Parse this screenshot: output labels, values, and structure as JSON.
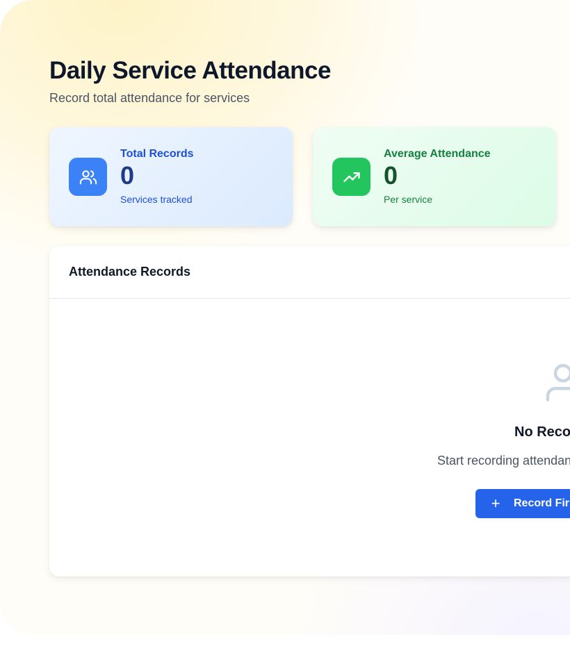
{
  "header": {
    "title": "Daily Service Attendance",
    "subtitle": "Record total attendance for services"
  },
  "stats": [
    {
      "label": "Total Records",
      "value": "0",
      "caption": "Services tracked",
      "icon": "users-icon",
      "color": "#3b82f6"
    },
    {
      "label": "Average Attendance",
      "value": "0",
      "caption": "Per service",
      "icon": "trending-up-icon",
      "color": "#22c55e"
    }
  ],
  "records": {
    "title": "Attendance Records",
    "empty_icon": "user-icon",
    "empty_title": "No Records Yet",
    "empty_description": "Start recording attendance for your services",
    "action_icon": "plus-icon",
    "action_label": "Record First Service"
  },
  "colors": {
    "primary": "#2563eb",
    "title_text": "#0f172a",
    "muted_text": "#4b5563"
  }
}
